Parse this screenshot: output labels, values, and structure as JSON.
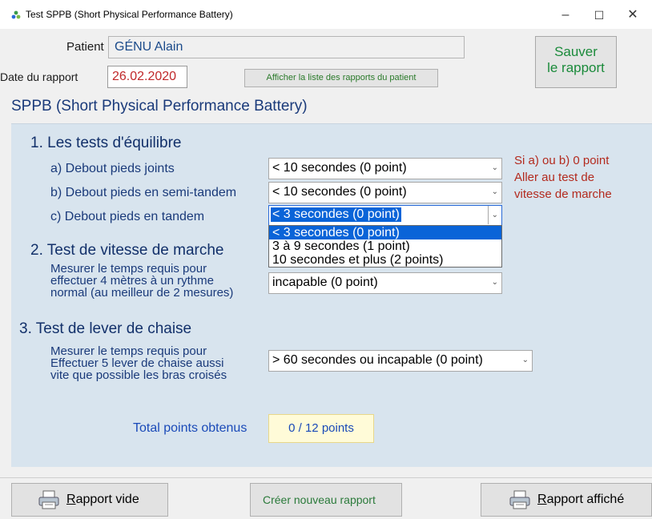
{
  "window": {
    "title": "Test SPPB (Short Physical Performance Battery)",
    "minimize_glyph": "–",
    "maximize_glyph": "☐",
    "close_glyph": "✕"
  },
  "header": {
    "patient_label": "Patient",
    "patient_name": "GÉNU Alain",
    "date_label": "Date du rapport",
    "date_value": "26.02.2020",
    "list_button": "Afficher la liste des rapports du patient",
    "save_button_line1": "Sauver",
    "save_button_line2": "le rapport"
  },
  "section_title": "SPPB (Short Physical Performance Battery)",
  "balance": {
    "title": "1. Les tests d'équilibre",
    "a_label": "a) Debout pieds joints",
    "a_value": "< 10 secondes (0 point)",
    "b_label": "b) Debout pieds en semi-tandem",
    "b_value": "< 10 secondes (0 point)",
    "c_label": "c) Debout pieds en tandem",
    "c_value": "< 3 secondes (0 point)",
    "c_options": [
      "< 3 secondes (0 point)",
      "3 à 9 secondes (1 point)",
      "10 secondes et plus (2 points)"
    ],
    "note_line1": "Si a) ou b)  0 point",
    "note_line2": "Aller au test de",
    "note_line3": "vitesse de marche"
  },
  "gait": {
    "title": "2. Test de vitesse de marche",
    "desc_line1": "Mesurer le temps requis pour",
    "desc_line2": "effectuer 4 mètres à un rythme",
    "desc_line3": "normal (au meilleur de 2 mesures)",
    "value": "incapable (0 point)"
  },
  "chair": {
    "title": "3. Test de lever de chaise",
    "desc_line1": "Mesurer le temps requis pour",
    "desc_line2": "Effectuer 5 lever de chaise aussi",
    "desc_line3": "vite que possible les bras croisés",
    "value": "> 60 secondes ou incapable (0 point)"
  },
  "total": {
    "label": "Total points obtenus",
    "value": "0 / 12 points"
  },
  "footer": {
    "empty_report_label_u": "R",
    "empty_report_label_rest": "apport vide",
    "new_report": "Créer nouveau rapport",
    "shown_report_label_u": "R",
    "shown_report_label_rest": "apport affiché"
  },
  "colors": {
    "panel": "#d8e4ee",
    "heading": "#12306a",
    "accent_green": "#1a8a3a",
    "note_red": "#b32a1e",
    "selection": "#0a64d8"
  },
  "icons": [
    "app-icon",
    "printer-icon"
  ]
}
